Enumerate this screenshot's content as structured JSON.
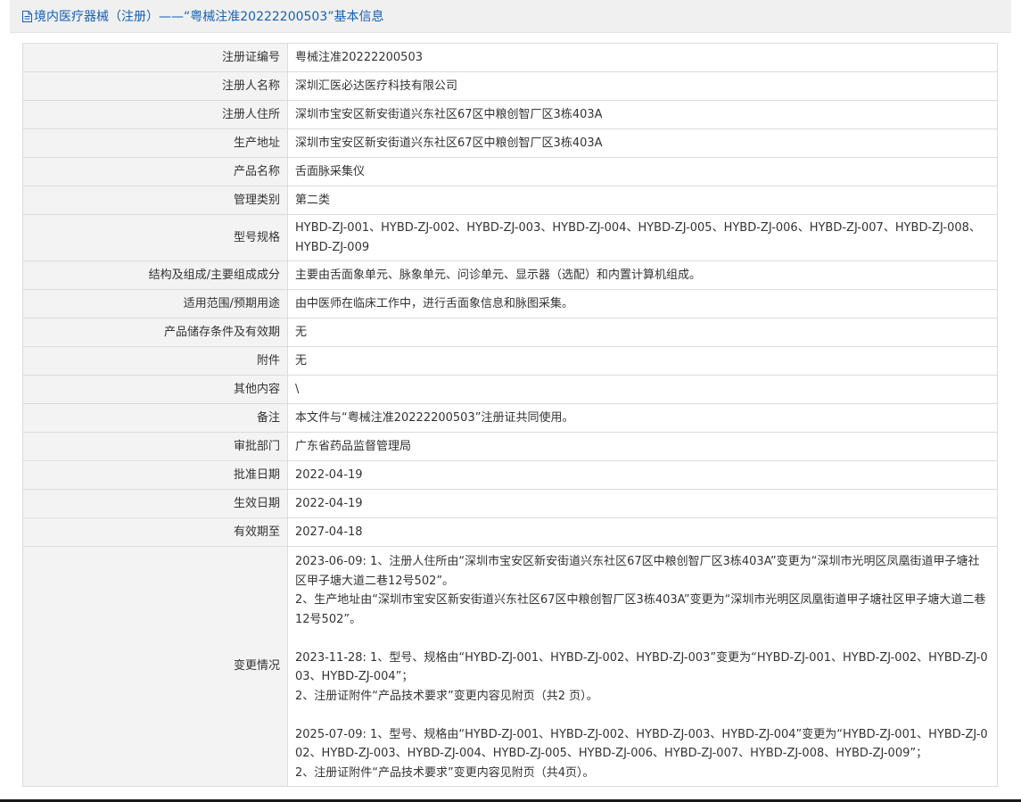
{
  "header": {
    "icon": "document-icon",
    "title": "境内医疗器械（注册）——“粤械注准20222200503”基本信息"
  },
  "rows": [
    {
      "label": "注册证编号",
      "value": "粤械注准20222200503"
    },
    {
      "label": "注册人名称",
      "value": "深圳汇医必达医疗科技有限公司"
    },
    {
      "label": "注册人住所",
      "value": "深圳市宝安区新安街道兴东社区67区中粮创智厂区3栋403A"
    },
    {
      "label": "生产地址",
      "value": "深圳市宝安区新安街道兴东社区67区中粮创智厂区3栋403A"
    },
    {
      "label": "产品名称",
      "value": "舌面脉采集仪"
    },
    {
      "label": "管理类别",
      "value": "第二类"
    },
    {
      "label": "型号规格",
      "value": "HYBD-ZJ-001、HYBD-ZJ-002、HYBD-ZJ-003、HYBD-ZJ-004、HYBD-ZJ-005、HYBD-ZJ-006、HYBD-ZJ-007、HYBD-ZJ-008、HYBD-ZJ-009"
    },
    {
      "label": "结构及组成/主要组成成分",
      "value": "主要由舌面象单元、脉象单元、问诊单元、显示器（选配）和内置计算机组成。"
    },
    {
      "label": "适用范围/预期用途",
      "value": "由中医师在临床工作中，进行舌面象信息和脉图采集。"
    },
    {
      "label": "产品储存条件及有效期",
      "value": "无"
    },
    {
      "label": "附件",
      "value": "无"
    },
    {
      "label": "其他内容",
      "value": "\\"
    },
    {
      "label": "备注",
      "value": "本文件与“粤械注准20222200503”注册证共同使用。"
    },
    {
      "label": "审批部门",
      "value": "广东省药品监督管理局"
    },
    {
      "label": "批准日期",
      "value": "2022-04-19"
    },
    {
      "label": "生效日期",
      "value": "2022-04-19"
    },
    {
      "label": "有效期至",
      "value": "2027-04-18"
    }
  ],
  "changes": {
    "label": "变更情况",
    "entries": [
      {
        "lines": [
          "2023-06-09: 1、注册人住所由“深圳市宝安区新安街道兴东社区67区中粮创智厂区3栋403A”变更为“深圳市光明区凤凰街道甲子塘社区甲子塘大道二巷12号502”。",
          "2、生产地址由“深圳市宝安区新安街道兴东社区67区中粮创智厂区3栋403A”变更为“深圳市光明区凤凰街道甲子塘社区甲子塘大道二巷12号502”。"
        ]
      },
      {
        "lines": [
          "2023-11-28: 1、型号、规格由“HYBD-ZJ-001、HYBD-ZJ-002、HYBD-ZJ-003”变更为“HYBD-ZJ-001、HYBD-ZJ-002、HYBD-ZJ-003、HYBD-ZJ-004”；",
          "2、注册证附件“产品技术要求”变更内容见附页（共2 页）。"
        ]
      },
      {
        "lines": [
          "2025-07-09: 1、型号、规格由“HYBD-ZJ-001、HYBD-ZJ-002、HYBD-ZJ-003、HYBD-ZJ-004”变更为“HYBD-ZJ-001、HYBD-ZJ-002、HYBD-ZJ-003、HYBD-ZJ-004、HYBD-ZJ-005、HYBD-ZJ-006、HYBD-ZJ-007、HYBD-ZJ-008、HYBD-ZJ-009”；",
          "2、注册证附件“产品技术要求”变更内容见附页（共4页）。"
        ]
      }
    ]
  }
}
